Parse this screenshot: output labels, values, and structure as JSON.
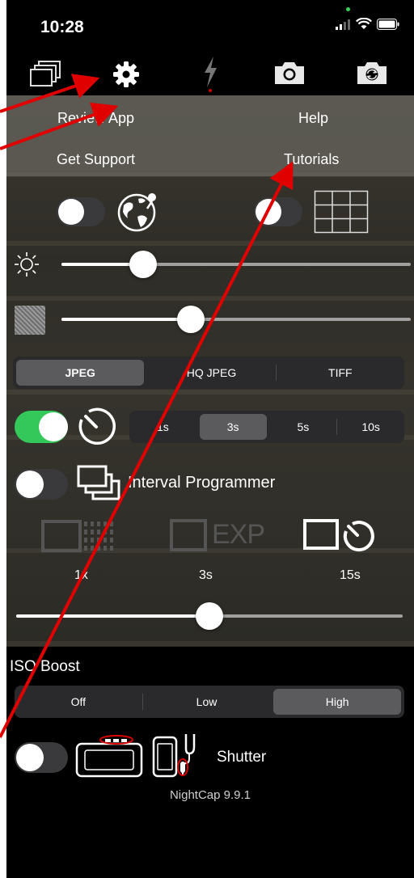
{
  "status": {
    "time": "10:28"
  },
  "menu": {
    "review_app": "Review App",
    "help": "Help",
    "get_support": "Get Support",
    "tutorials": "Tutorials"
  },
  "format": {
    "options": [
      "JPEG",
      "HQ JPEG",
      "TIFF"
    ],
    "selected": "JPEG"
  },
  "timer": {
    "options": [
      "1s",
      "3s",
      "5s",
      "10s"
    ],
    "selected": "3s",
    "enabled": true
  },
  "interval": {
    "label": "Interval Programmer",
    "count": "1x",
    "exposure": "3s",
    "interval": "15s",
    "exp_icon_text": "EXP",
    "enabled": false
  },
  "sliders": {
    "brightness_level": 0.21,
    "noise_level": 0.36,
    "interval_level": 0.5
  },
  "iso": {
    "label": "ISO Boost",
    "options": [
      "Off",
      "Low",
      "High"
    ],
    "selected": "High"
  },
  "shutter": {
    "label": "Shutter",
    "enabled": false
  },
  "version": "NightCap 9.9.1",
  "colors": {
    "accent_green": "#34c759",
    "arrow": "#e00000"
  }
}
